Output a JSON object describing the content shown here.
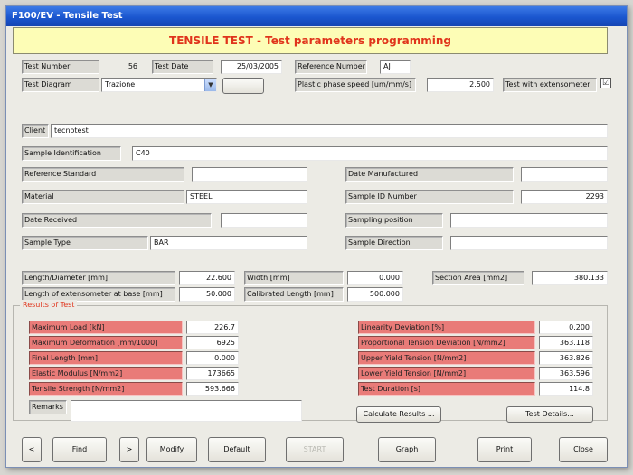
{
  "window": {
    "title": "F100/EV - Tensile Test"
  },
  "banner": "TENSILE TEST - Test parameters programming",
  "header": {
    "test_number_label": "Test Number",
    "test_number": "56",
    "test_date_label": "Test Date",
    "test_date": "25/03/2005",
    "reference_number_label": "Reference Number",
    "reference_number": "AJ",
    "test_diagram_label": "Test Diagram",
    "test_diagram": "Trazione",
    "plastic_speed_label": "Plastic phase speed [um/mm/s]",
    "plastic_speed": "2.500",
    "extensometer_label": "Test with extensometer",
    "extensometer_checked": "☑"
  },
  "client": {
    "label": "Client",
    "value": "tecnotest"
  },
  "sample_identification": {
    "label": "Sample Identification",
    "value": "C40"
  },
  "left_fields": [
    {
      "label": "Reference Standard",
      "value": ""
    },
    {
      "label": "Material",
      "value": "STEEL"
    },
    {
      "label": "Date Received",
      "value": ""
    },
    {
      "label": "Sample Type",
      "value": "BAR"
    }
  ],
  "right_fields": [
    {
      "label": "Date Manufactured",
      "value": ""
    },
    {
      "label": "Sample ID Number",
      "value": "2293"
    },
    {
      "label": "Sampling position",
      "value": ""
    },
    {
      "label": "Sample Direction",
      "value": ""
    }
  ],
  "dimensions": {
    "length_label": "Length/Diameter [mm]",
    "length": "22.600",
    "width_label": "Width [mm]",
    "width": "0.000",
    "section_label": "Section Area [mm2]",
    "section": "380.133",
    "ext_label": "Length of extensometer at base [mm]",
    "ext": "50.000",
    "calibrated_label": "Calibrated Length [mm]",
    "calibrated": "500.000"
  },
  "results": {
    "title": "Results of Test",
    "left": [
      {
        "label": "Maximum Load [kN]",
        "value": "226.7"
      },
      {
        "label": "Maximum Deformation [mm/1000]",
        "value": "6925"
      },
      {
        "label": "Final Length [mm]",
        "value": "0.000"
      },
      {
        "label": "Elastic Modulus [N/mm2]",
        "value": "173665"
      },
      {
        "label": "Tensile Strength [N/mm2]",
        "value": "593.666"
      }
    ],
    "right": [
      {
        "label": "Linearity Deviation [%]",
        "value": "0.200"
      },
      {
        "label": "Proportional Tension Deviation [N/mm2]",
        "value": "363.118"
      },
      {
        "label": "Upper Yield Tension [N/mm2]",
        "value": "363.826"
      },
      {
        "label": "Lower Yield Tension [N/mm2]",
        "value": "363.596"
      },
      {
        "label": "Test Duration [s]",
        "value": "114.8"
      }
    ],
    "remarks_label": "Remarks",
    "remarks": "",
    "calculate_label": "Calculate Results ...",
    "details_label": "Test Details..."
  },
  "toolbar": {
    "prev": "<",
    "find": "Find",
    "next": ">",
    "modify": "Modify",
    "default": "Default",
    "start": "START",
    "graph": "Graph",
    "print": "Print",
    "close": "Close"
  }
}
